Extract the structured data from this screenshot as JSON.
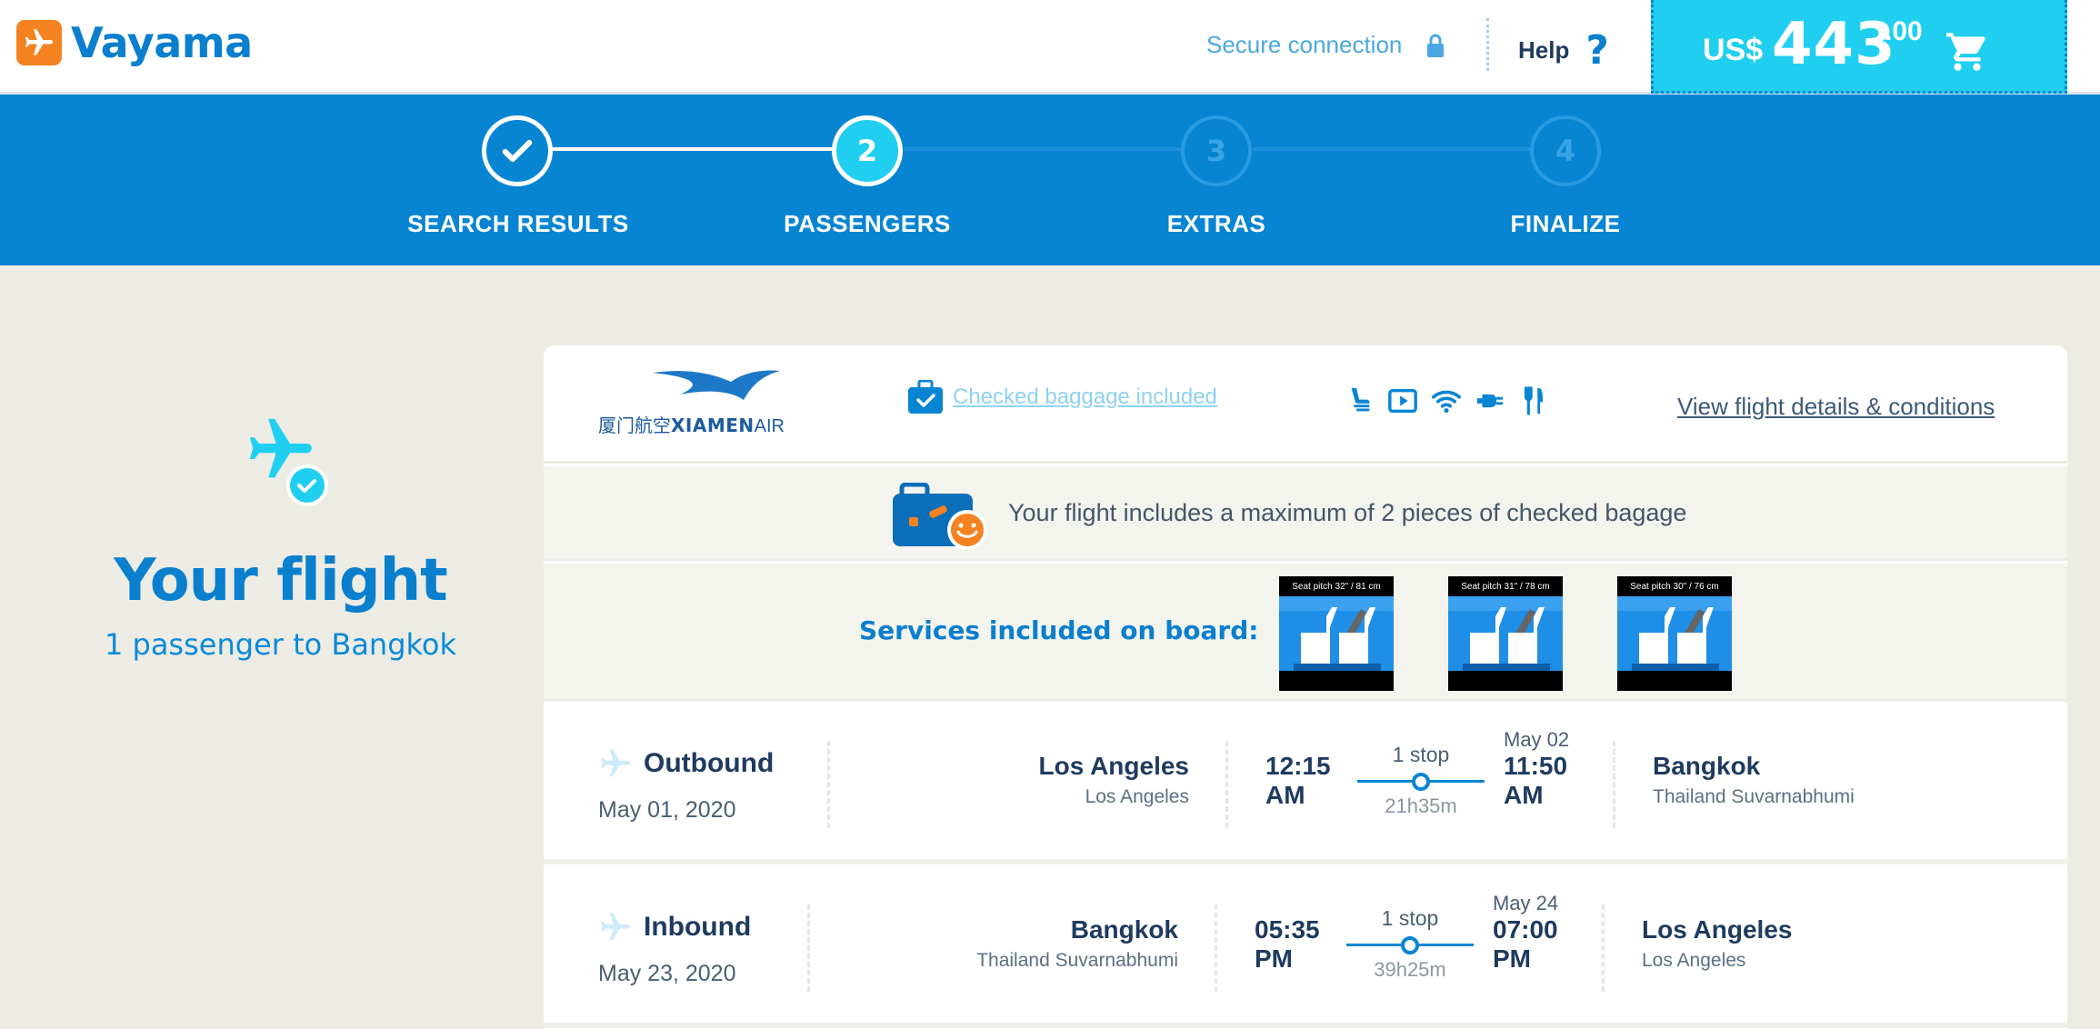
{
  "header": {
    "brand": "Vayama",
    "secure_label": "Secure connection",
    "help_label": "Help",
    "help_icon": "?",
    "cart": {
      "currency": "US$",
      "amount": "443",
      "cents": ".00"
    }
  },
  "steps": [
    {
      "number": "",
      "label": "SEARCH RESULTS",
      "state": "done"
    },
    {
      "number": "2",
      "label": "PASSENGERS",
      "state": "active"
    },
    {
      "number": "3",
      "label": "EXTRAS",
      "state": "todo"
    },
    {
      "number": "4",
      "label": "FINALIZE",
      "state": "todo"
    }
  ],
  "summary": {
    "title": "Your flight",
    "subtitle": "1 passenger to Bangkok"
  },
  "airline": {
    "name_cn": "厦门航空",
    "name_main": "XIAMEN",
    "name_suffix": "AIR",
    "baggage_link": "Checked baggage included",
    "amenities": [
      "seat-icon",
      "video-icon",
      "wifi-icon",
      "power-plug-icon",
      "meal-icon"
    ],
    "details_link": "View flight details & conditions"
  },
  "baggage_note": "Your flight includes a maximum of 2 pieces of checked bagage",
  "services": {
    "label": "Services included on board:",
    "seats": [
      {
        "caption": "Seat pitch 32\" / 81 cm"
      },
      {
        "caption": "Seat pitch 31\" / 78 cm"
      },
      {
        "caption": "Seat pitch 30\" / 76 cm"
      }
    ]
  },
  "flights": [
    {
      "direction": "Outbound",
      "date": "May 01, 2020",
      "from_city": "Los Angeles",
      "from_airport": "Los Angeles",
      "depart_time": "12:15",
      "depart_ampm": "AM",
      "stops": "1 stop",
      "duration": "21h35m",
      "arrive_date": "May 02",
      "arrive_time": "11:50",
      "arrive_ampm": "AM",
      "to_city": "Bangkok",
      "to_airport": "Thailand Suvarnabhumi"
    },
    {
      "direction": "Inbound",
      "date": "May 23, 2020",
      "from_city": "Bangkok",
      "from_airport": "Thailand Suvarnabhumi",
      "depart_time": "05:35",
      "depart_ampm": "PM",
      "stops": "1 stop",
      "duration": "39h25m",
      "arrive_date": "May 24",
      "arrive_time": "07:00",
      "arrive_ampm": "PM",
      "to_city": "Los Angeles",
      "to_airport": "Los Angeles"
    }
  ],
  "colors": {
    "brand_blue": "#0a7fce",
    "steps_bg": "#0785d3",
    "accent_cyan": "#20cff0",
    "logo_orange": "#f58220"
  }
}
